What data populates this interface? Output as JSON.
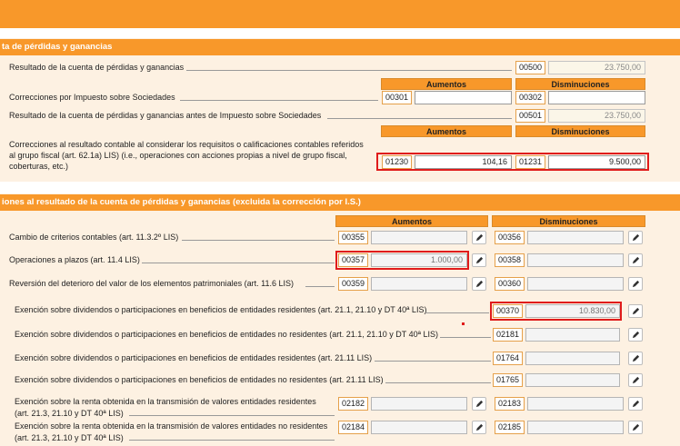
{
  "section1": {
    "title": "ta de pérdidas y ganancias",
    "col_aumentos": "Aumentos",
    "col_disminuciones": "Disminuciones",
    "rows": [
      {
        "label": "Resultado de la cuenta de pérdidas y ganancias",
        "code": "00500",
        "value": "23.750,00"
      },
      {
        "label": "Correcciones por Impuesto sobre Sociedades",
        "code_a": "00301",
        "value_a": "",
        "code_d": "00302",
        "value_d": ""
      },
      {
        "label": "Resultado de la cuenta de pérdidas y ganancias antes de Impuesto sobre Sociedades",
        "code": "00501",
        "value": "23.750,00"
      },
      {
        "label": "Correcciones al resultado contable al considerar los requisitos o calificaciones contables referidos al grupo fiscal (art. 62.1a) LIS) (i.e., operaciones con acciones propias a nivel de grupo fiscal, coberturas, etc.)",
        "code_a": "01230",
        "value_a": "104,16",
        "code_d": "01231",
        "value_d": "9.500,00"
      }
    ]
  },
  "section2": {
    "title": "iones al resultado de la cuenta de pérdidas y ganancias (excluida la corrección por I.S.)",
    "col_aumentos": "Aumentos",
    "col_disminuciones": "Disminuciones",
    "rows": [
      {
        "label": "Cambio de criterios contables (art. 11.3.2º LIS)",
        "code_a": "00355",
        "value_a": "",
        "code_d": "00356",
        "value_d": ""
      },
      {
        "label": "Operaciones a plazos (art. 11.4 LIS)",
        "code_a": "00357",
        "value_a": "1.000,00",
        "code_d": "00358",
        "value_d": ""
      },
      {
        "label": "Reversión del deterioro del valor de los elementos patrimoniales (art. 11.6 LIS)",
        "code_a": "00359",
        "value_a": "",
        "code_d": "00360",
        "value_d": ""
      },
      {
        "label": "Exención sobre dividendos o participaciones en beneficios de entidades residentes (art. 21.1, 21.10 y DT 40ª LIS)",
        "code_d": "00370",
        "value_d": "10.830,00"
      },
      {
        "label": "Exención sobre dividendos o participaciones en beneficios de entidades no residentes (art. 21.1, 21.10 y DT 40ª LIS)",
        "code_d": "02181",
        "value_d": ""
      },
      {
        "label": "Exención sobre dividendos o participaciones en beneficios de entidades residentes (art. 21.11 LIS)",
        "code_d": "01764",
        "value_d": ""
      },
      {
        "label": "Exención sobre dividendos o participaciones en beneficios de entidades no residentes (art. 21.11 LIS)",
        "code_d": "01765",
        "value_d": ""
      },
      {
        "label_l1": "Exención sobre la renta obtenida en la transmisión de valores entidades residentes",
        "label_l2": "(art. 21.3, 21.10 y DT 40ª LIS)",
        "code_a": "02182",
        "value_a": "",
        "code_d": "02183",
        "value_d": ""
      },
      {
        "label_l1": "Exención sobre la renta obtenida en la transmisión de valores entidades no residentes",
        "label_l2": "(art. 21.3, 21.10 y DT 40ª LIS)",
        "code_a": "02184",
        "value_a": "",
        "code_d": "02185",
        "value_d": ""
      }
    ]
  },
  "icons": {
    "edit": "pencil-icon"
  },
  "colors": {
    "accent": "#f8982a",
    "panel": "#fdf1e2",
    "highlight": "#e01b1b"
  }
}
